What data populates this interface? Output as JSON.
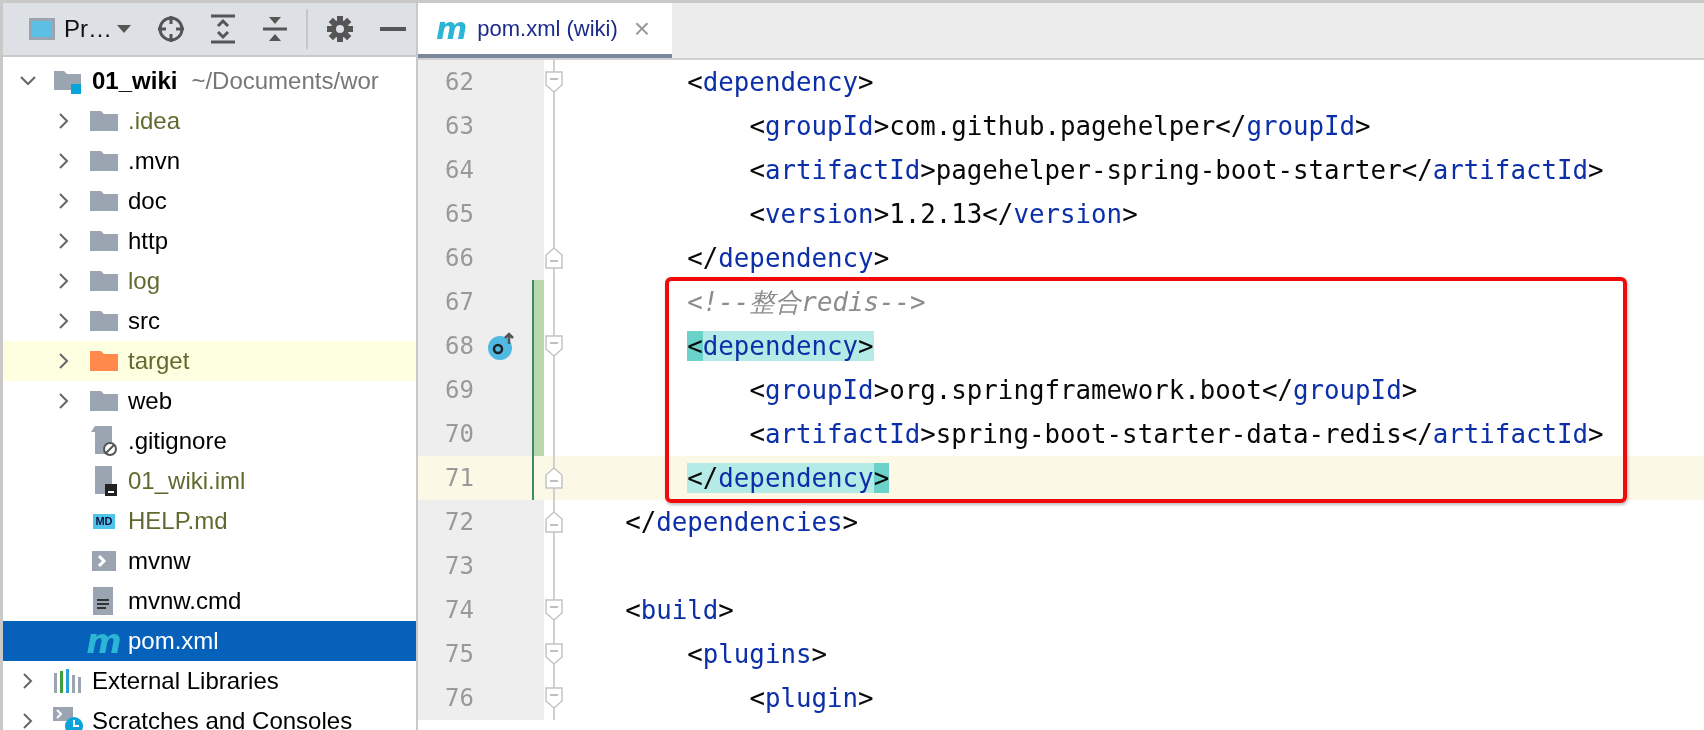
{
  "project_panel": {
    "title": "Pr…"
  },
  "tree": [
    {
      "label": "01_wiki",
      "path": "~/Documents/wor",
      "kind": "module",
      "color": "#000000",
      "expandable": true,
      "expanded": true,
      "selected": false,
      "highlighted": false,
      "children": [
        {
          "label": ".idea",
          "kind": "folder",
          "color": "#5f6b2e",
          "expandable": true,
          "expanded": false,
          "selected": false,
          "highlighted": false
        },
        {
          "label": ".mvn",
          "kind": "folder",
          "color": "#000000",
          "expandable": true,
          "expanded": false,
          "selected": false,
          "highlighted": false
        },
        {
          "label": "doc",
          "kind": "folder",
          "color": "#000000",
          "expandable": true,
          "expanded": false,
          "selected": false,
          "highlighted": false
        },
        {
          "label": "http",
          "kind": "folder",
          "color": "#000000",
          "expandable": true,
          "expanded": false,
          "selected": false,
          "highlighted": false
        },
        {
          "label": "log",
          "kind": "folder",
          "color": "#5f6b2e",
          "expandable": true,
          "expanded": false,
          "selected": false,
          "highlighted": false
        },
        {
          "label": "src",
          "kind": "folder",
          "color": "#000000",
          "expandable": true,
          "expanded": false,
          "selected": false,
          "highlighted": false
        },
        {
          "label": "target",
          "kind": "excluded-folder",
          "color": "#5f6b2e",
          "expandable": true,
          "expanded": false,
          "selected": false,
          "highlighted": true
        },
        {
          "label": "web",
          "kind": "folder",
          "color": "#000000",
          "expandable": true,
          "expanded": false,
          "selected": false,
          "highlighted": false
        },
        {
          "label": ".gitignore",
          "kind": "ignore-file",
          "color": "#000000",
          "expandable": false,
          "selected": false,
          "highlighted": false
        },
        {
          "label": "01_wiki.iml",
          "kind": "module-file",
          "color": "#5f6b2e",
          "expandable": false,
          "selected": false,
          "highlighted": false
        },
        {
          "label": "HELP.md",
          "kind": "markdown",
          "badge": "MD",
          "color": "#5f6b2e",
          "expandable": false,
          "selected": false,
          "highlighted": false
        },
        {
          "label": "mvnw",
          "kind": "script",
          "color": "#000000",
          "expandable": false,
          "selected": false,
          "highlighted": false
        },
        {
          "label": "mvnw.cmd",
          "kind": "text-file",
          "color": "#000000",
          "expandable": false,
          "selected": false,
          "highlighted": false
        },
        {
          "label": "pom.xml",
          "kind": "maven",
          "badge": "m",
          "color": "#ffffff",
          "expandable": false,
          "selected": true,
          "highlighted": false
        }
      ]
    },
    {
      "label": "External Libraries",
      "kind": "libraries",
      "color": "#000000",
      "expandable": true,
      "expanded": false,
      "selected": false,
      "highlighted": false
    },
    {
      "label": "Scratches and Consoles",
      "kind": "scratches",
      "color": "#000000",
      "expandable": true,
      "expanded": false,
      "selected": false,
      "highlighted": false
    }
  ],
  "tabs": [
    {
      "label": "pom.xml (wiki)",
      "badge": "m",
      "close": "×",
      "selected": true
    }
  ],
  "blocks": [
    {
      "framed": false,
      "lines": [
        {
          "number": "62",
          "fold_open": true,
          "fold_close": false,
          "changed": false,
          "current": false,
          "gutter_marker": false,
          "tokens": [
            {
              "kind": "plain",
              "s": "        <"
            },
            {
              "kind": "tag",
              "s": "dependency"
            },
            {
              "kind": "plain",
              "s": ">"
            }
          ]
        },
        {
          "number": "63",
          "fold_open": false,
          "fold_close": false,
          "changed": false,
          "current": false,
          "gutter_marker": false,
          "tokens": [
            {
              "kind": "plain",
              "s": "            <"
            },
            {
              "kind": "tag",
              "s": "groupId"
            },
            {
              "kind": "plain",
              "s": ">com.github.pagehelper</"
            },
            {
              "kind": "tag",
              "s": "groupId"
            },
            {
              "kind": "plain",
              "s": ">"
            }
          ]
        },
        {
          "number": "64",
          "fold_open": false,
          "fold_close": false,
          "changed": false,
          "current": false,
          "gutter_marker": false,
          "tokens": [
            {
              "kind": "plain",
              "s": "            <"
            },
            {
              "kind": "tag",
              "s": "artifactId"
            },
            {
              "kind": "plain",
              "s": ">pagehelper-spring-boot-starter</"
            },
            {
              "kind": "tag",
              "s": "artifactId"
            },
            {
              "kind": "plain",
              "s": ">"
            }
          ]
        },
        {
          "number": "65",
          "fold_open": false,
          "fold_close": false,
          "changed": false,
          "current": false,
          "gutter_marker": false,
          "tokens": [
            {
              "kind": "plain",
              "s": "            <"
            },
            {
              "kind": "tag",
              "s": "version"
            },
            {
              "kind": "plain",
              "s": ">1.2.13</"
            },
            {
              "kind": "tag",
              "s": "version"
            },
            {
              "kind": "plain",
              "s": ">"
            }
          ]
        },
        {
          "number": "66",
          "fold_open": false,
          "fold_close": true,
          "changed": false,
          "current": false,
          "gutter_marker": false,
          "tokens": [
            {
              "kind": "plain",
              "s": "        </"
            },
            {
              "kind": "tag",
              "s": "dependency"
            },
            {
              "kind": "plain",
              "s": ">"
            }
          ]
        }
      ]
    },
    {
      "framed": true,
      "lines": [
        {
          "number": "67",
          "fold_open": false,
          "fold_close": false,
          "changed": true,
          "current": false,
          "gutter_marker": false,
          "tokens": [
            {
              "kind": "comment",
              "s": "        <!--整合redis-->"
            }
          ]
        },
        {
          "number": "68",
          "fold_open": true,
          "fold_close": false,
          "changed": true,
          "current": false,
          "gutter_marker": true,
          "tokens": [
            {
              "kind": "match-edge",
              "s": "        <"
            },
            {
              "kind": "match-tag",
              "s": "dependency"
            },
            {
              "kind": "match-plain",
              "s": ">"
            }
          ]
        },
        {
          "number": "69",
          "fold_open": false,
          "fold_close": false,
          "changed": true,
          "current": false,
          "gutter_marker": false,
          "tokens": [
            {
              "kind": "plain",
              "s": "            <"
            },
            {
              "kind": "tag",
              "s": "groupId"
            },
            {
              "kind": "plain",
              "s": ">org.springframework.boot</"
            },
            {
              "kind": "tag",
              "s": "groupId"
            },
            {
              "kind": "plain",
              "s": ">"
            }
          ]
        },
        {
          "number": "70",
          "fold_open": false,
          "fold_close": false,
          "changed": true,
          "current": false,
          "gutter_marker": false,
          "tokens": [
            {
              "kind": "plain",
              "s": "            <"
            },
            {
              "kind": "tag",
              "s": "artifactId"
            },
            {
              "kind": "plain",
              "s": ">spring-boot-starter-data-redis</"
            },
            {
              "kind": "tag",
              "s": "artifactId"
            },
            {
              "kind": "plain",
              "s": ">"
            }
          ]
        },
        {
          "number": "71",
          "fold_open": false,
          "fold_close": true,
          "changed": true,
          "current": true,
          "gutter_marker": false,
          "tokens": [
            {
              "kind": "match-plain",
              "s": "        </"
            },
            {
              "kind": "match-tag",
              "s": "dependency"
            },
            {
              "kind": "match-edge",
              "s": ">"
            }
          ]
        }
      ]
    },
    {
      "framed": false,
      "lines": [
        {
          "number": "72",
          "fold_open": false,
          "fold_close": true,
          "changed": false,
          "current": false,
          "gutter_marker": false,
          "tokens": [
            {
              "kind": "plain",
              "s": "    </"
            },
            {
              "kind": "tag",
              "s": "dependencies"
            },
            {
              "kind": "plain",
              "s": ">"
            }
          ]
        },
        {
          "number": "73",
          "fold_open": false,
          "fold_close": false,
          "changed": false,
          "current": false,
          "gutter_marker": false
        },
        {
          "number": "74",
          "fold_open": true,
          "fold_close": false,
          "changed": false,
          "current": false,
          "gutter_marker": false,
          "tokens": [
            {
              "kind": "plain",
              "s": "    <"
            },
            {
              "kind": "tag",
              "s": "build"
            },
            {
              "kind": "plain",
              "s": ">"
            }
          ]
        },
        {
          "number": "75",
          "fold_open": true,
          "fold_close": false,
          "changed": false,
          "current": false,
          "gutter_marker": false,
          "tokens": [
            {
              "kind": "plain",
              "s": "        <"
            },
            {
              "kind": "tag",
              "s": "plugins"
            },
            {
              "kind": "plain",
              "s": ">"
            }
          ]
        },
        {
          "number": "76",
          "fold_open": true,
          "fold_close": false,
          "changed": false,
          "current": false,
          "gutter_marker": false,
          "tokens": [
            {
              "kind": "plain",
              "s": "            <"
            },
            {
              "kind": "tag",
              "s": "plugin"
            },
            {
              "kind": "plain",
              "s": ">"
            }
          ]
        }
      ]
    }
  ]
}
